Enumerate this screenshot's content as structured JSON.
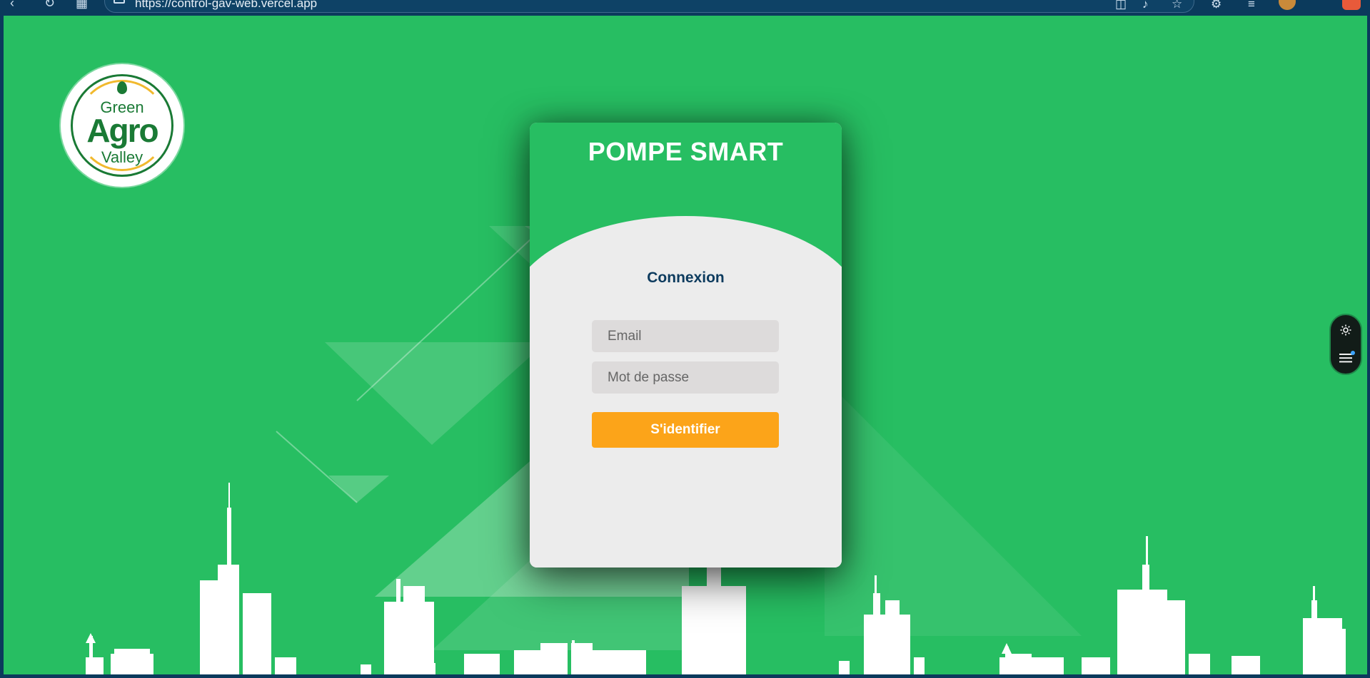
{
  "browser": {
    "url": "https://control-gav-web.vercel.app",
    "icons": [
      "back-icon",
      "refresh-icon",
      "apps-icon",
      "lock-icon",
      "split-view-icon",
      "read-aloud-icon",
      "favorite-icon",
      "extensions-icon",
      "favorites-bar-icon",
      "profile-avatar",
      "copilot-icon"
    ]
  },
  "logo": {
    "top": "Green",
    "middle": "Agro",
    "bottom": "Valley"
  },
  "card": {
    "app_title": "POMPE SMART",
    "form_title": "Connexion",
    "email_placeholder": "Email",
    "password_placeholder": "Mot de passe",
    "submit_label": "S'identifier"
  },
  "side_widget": {
    "icons": [
      "gear-icon",
      "menu-icon"
    ]
  },
  "colors": {
    "background": "#27be62",
    "card": "#ececec",
    "title_blue": "#0d3b5e",
    "button_orange": "#fca419",
    "browser_bar": "#0b3a5c"
  }
}
